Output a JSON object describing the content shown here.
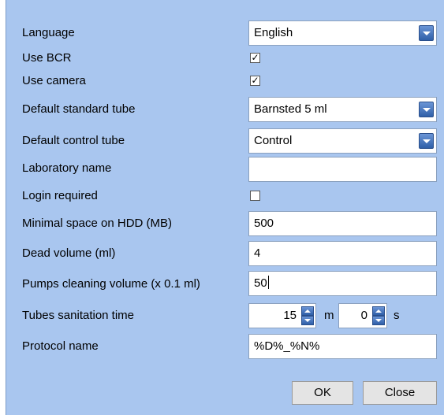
{
  "settings": {
    "language": {
      "label": "Language",
      "value": "English"
    },
    "use_bcr": {
      "label": "Use BCR",
      "checked": true
    },
    "use_camera": {
      "label": "Use camera",
      "checked": true
    },
    "default_standard_tube": {
      "label": "Default standard tube",
      "value": "Barnsted 5 ml"
    },
    "default_control_tube": {
      "label": "Default control tube",
      "value": "Control"
    },
    "laboratory_name": {
      "label": "Laboratory name",
      "value": ""
    },
    "login_required": {
      "label": "Login required",
      "checked": false
    },
    "minimal_space": {
      "label": "Minimal space on HDD (MB)",
      "value": "500"
    },
    "dead_volume": {
      "label": "Dead volume (ml)",
      "value": "4"
    },
    "pumps_cleaning_volume": {
      "label": "Pumps cleaning volume (x 0.1 ml)",
      "value": "50"
    },
    "tubes_sanitation_time": {
      "label": "Tubes sanitation time",
      "minutes": "15",
      "minutes_unit": "m",
      "seconds": "0",
      "seconds_unit": "s"
    },
    "protocol_name": {
      "label": "Protocol name",
      "value": "%D%_%N%"
    }
  },
  "buttons": {
    "ok": "OK",
    "close": "Close"
  },
  "glyphs": {
    "check": "✓"
  }
}
